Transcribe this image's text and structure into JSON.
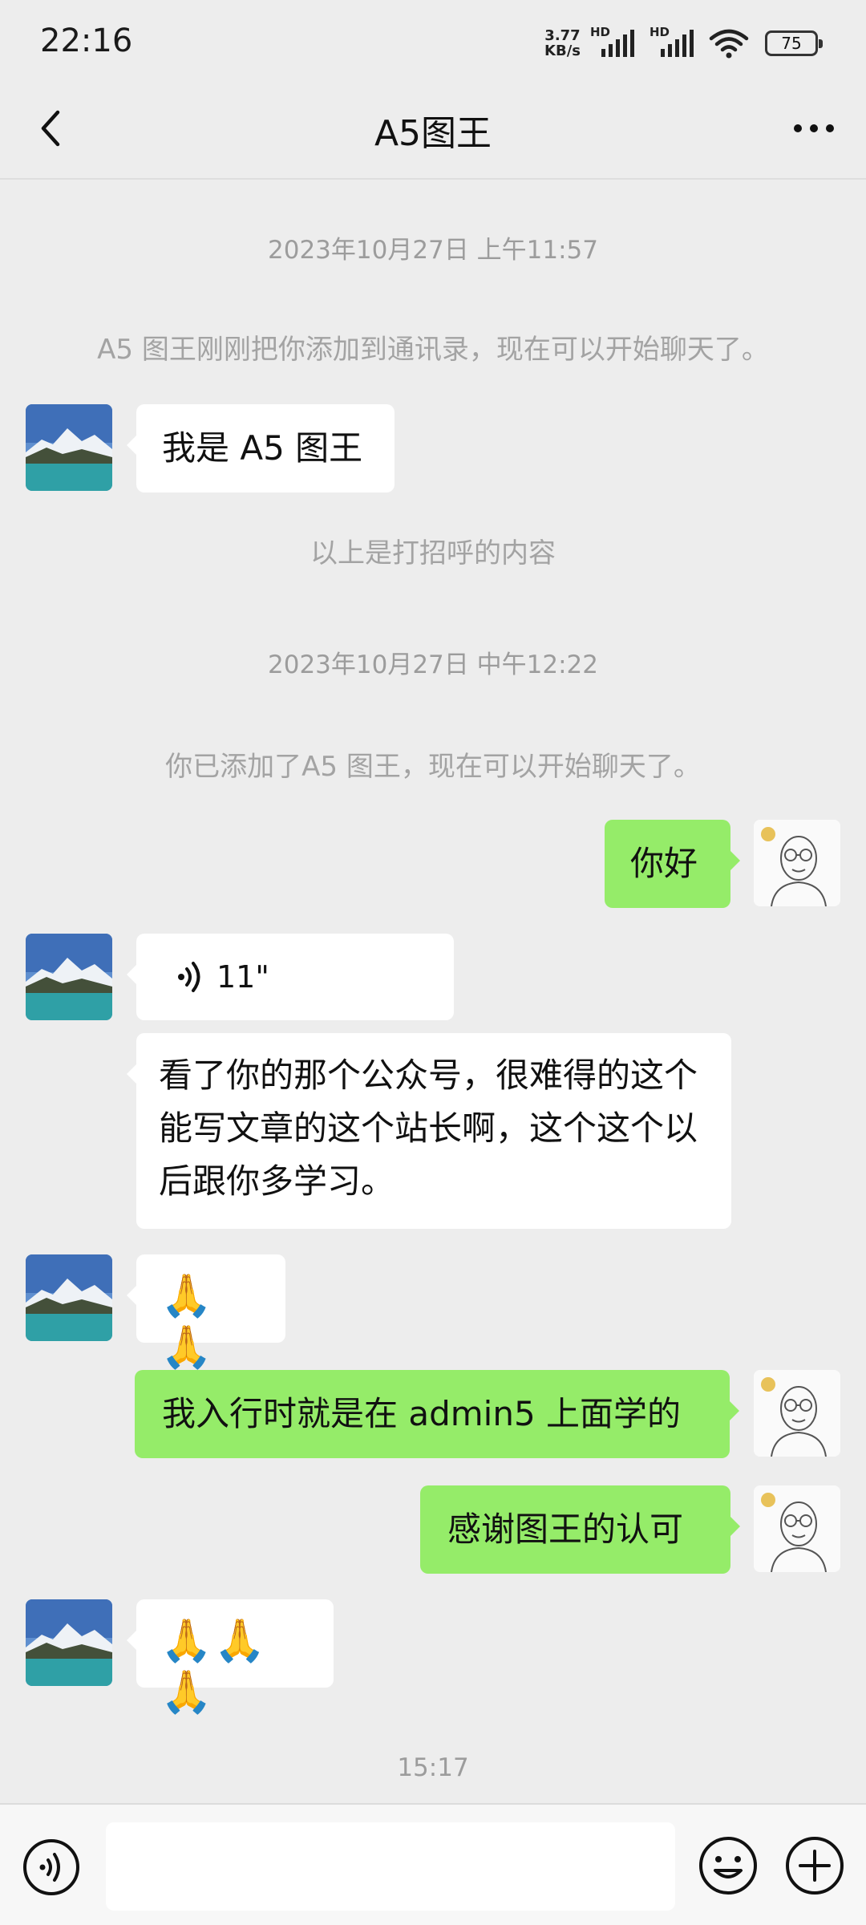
{
  "status_bar": {
    "time": "22:16",
    "net_speed_value": "3.77",
    "net_speed_unit": "KB/s",
    "signal_label_1": "HD",
    "signal_label_2": "HD",
    "battery": "75"
  },
  "header": {
    "title": "A5图王",
    "back_icon": "chevron-left-icon",
    "more_icon": "more-dots-icon"
  },
  "messages": {
    "time_1": "2023年10月27日 上午11:57",
    "notice_1": "A5 图王刚刚把你添加到通讯录，现在可以开始聊天了。",
    "msg_1": "我是 A5 图王",
    "notice_2": "以上是打招呼的内容",
    "time_2": "2023年10月27日 中午12:22",
    "notice_3": "你已添加了A5 图王，现在可以开始聊天了。",
    "msg_2": "你好",
    "voice_duration": "11\"",
    "msg_3": "看了你的那个公众号，很难得的这个能写文章的这个站长啊，这个这个以后跟你多学习。",
    "msg_4": "🙏🙏",
    "msg_5": "我入行时就是在 admin5 上面学的",
    "msg_6": "感谢图王的认可",
    "msg_7": "🙏🙏🙏",
    "time_3": "15:17"
  },
  "input_bar": {
    "placeholder": "",
    "voice_icon": "voice-mode-icon",
    "emoji_icon": "emoji-icon",
    "plus_icon": "plus-icon"
  },
  "colors": {
    "background": "#ededed",
    "outgoing_bubble": "#95ec69",
    "incoming_bubble": "#ffffff",
    "system_text": "#9c9c9c"
  }
}
